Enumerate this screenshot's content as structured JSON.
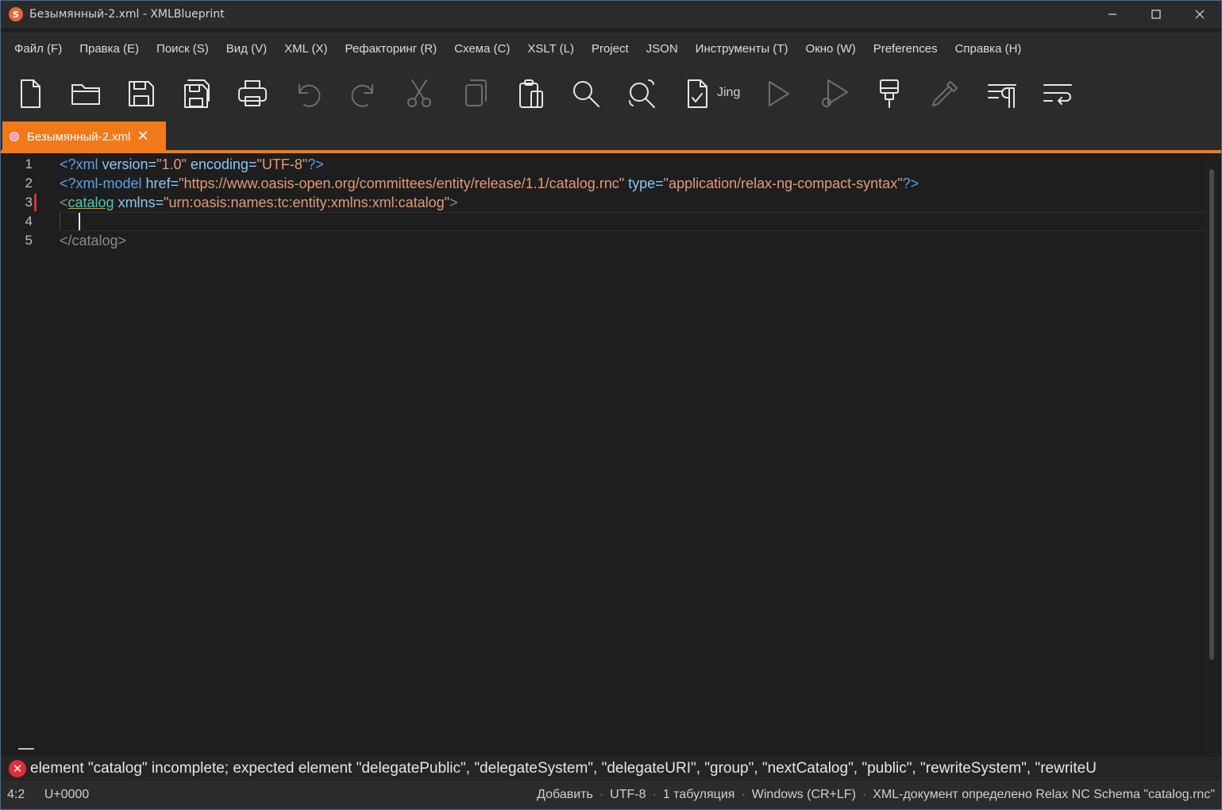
{
  "window": {
    "title": "Безымянный-2.xml - XMLBlueprint",
    "app_icon": "xmlblueprint-logo-icon"
  },
  "menu": [
    "Файл (F)",
    "Правка (E)",
    "Поиск (S)",
    "Вид (V)",
    "XML (X)",
    "Рефакторинг (R)",
    "Схема (C)",
    "XSLT (L)",
    "Project",
    "JSON",
    "Инструменты (T)",
    "Окно (W)",
    "Preferences",
    "Справка (H)"
  ],
  "toolbar": {
    "jing_label": "Jing"
  },
  "tab": {
    "label": "Безымянный-2.xml",
    "accent": "#f07a1a"
  },
  "editor": {
    "line_numbers": [
      "1",
      "2",
      "3",
      "4",
      "5"
    ],
    "line1": {
      "open": "<?xml",
      "attr1": " version=",
      "val1": "\"1.0\"",
      "attr2": " encoding=",
      "val2": "\"UTF-8\"",
      "close": "?>"
    },
    "line2": {
      "open": "<?xml-model",
      "attr1": " href=",
      "val1": "\"https://www.oasis-open.org/committees/entity/release/1.1/catalog.rnc\"",
      "attr2": " type=",
      "val2": "\"application/relax-ng-compact-syntax\"",
      "close": "?>"
    },
    "line3": {
      "lt": "<",
      "tag": "catalog",
      "attr1": " xmlns=",
      "val1": "\"urn:oasis:names:tc:entity:xmlns:xml:catalog\"",
      "gt": ">"
    },
    "line5": "</catalog>"
  },
  "error": {
    "message": "element \"catalog\" incomplete; expected element \"delegatePublic\", \"delegateSystem\", \"delegateURI\", \"group\", \"nextCatalog\", \"public\", \"rewriteSystem\", \"rewriteU"
  },
  "status": {
    "position": "4:2",
    "codepoint": "U+0000",
    "mode": "Добавить",
    "encoding": "UTF-8",
    "indent": "1 табуляция",
    "line_endings": "Windows (CR+LF)",
    "schema": "XML-документ определено Relax NC Schema \"catalog.rnc\""
  }
}
